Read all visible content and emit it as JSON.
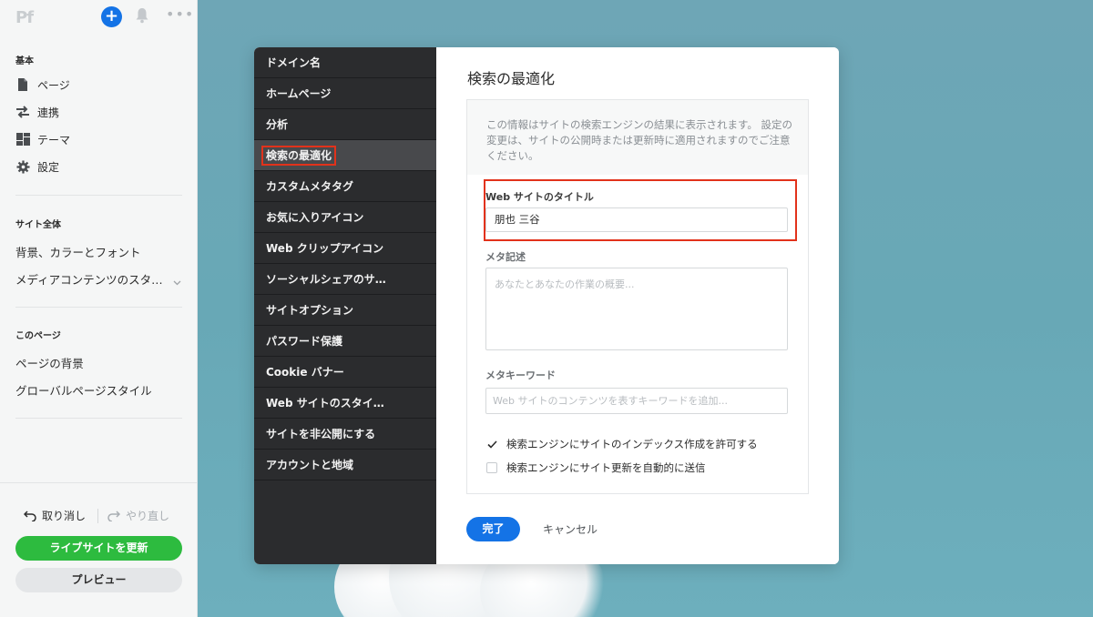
{
  "sidebar": {
    "logo": "Pf",
    "sections": {
      "basic": "基本",
      "site_wide": "サイト全体",
      "this_page": "このページ"
    },
    "basic_items": [
      "ページ",
      "連携",
      "テーマ",
      "設定"
    ],
    "site_items": [
      "背景、カラーとフォント",
      "メディアコンテンツのスタ…"
    ],
    "page_items": [
      "ページの背景",
      "グローバルページスタイル"
    ],
    "undo": "取り消し",
    "redo": "やり直し",
    "update_button": "ライブサイトを更新",
    "preview_button": "プレビュー"
  },
  "modal": {
    "nav_items": [
      "ドメイン名",
      "ホームページ",
      "分析",
      "検索の最適化",
      "カスタムメタタグ",
      "お気に入りアイコン",
      "Web クリップアイコン",
      "ソーシャルシェアのサ…",
      "サイトオプション",
      "パスワード保護",
      "Cookie バナー",
      "Web サイトのスタイ…",
      "サイトを非公開にする",
      "アカウントと地域"
    ],
    "active_index": 3,
    "title": "検索の最適化",
    "info_text": "この情報はサイトの検索エンジンの結果に表示されます。 設定の変更は、サイトの公開時または更新時に適用されますのでご注意ください。",
    "site_title_label": "Web サイトのタイトル",
    "site_title_value": "朋也 三谷",
    "meta_desc_label": "メタ記述",
    "meta_desc_placeholder": "あなたとあなたの作業の概要...",
    "meta_keywords_label": "メタキーワード",
    "meta_keywords_placeholder": "Web サイトのコンテンツを表すキーワードを追加...",
    "checkbox_index_label": "検索エンジンにサイトのインデックス作成を許可する",
    "checkbox_index_checked": true,
    "checkbox_auto_label": "検索エンジンにサイト更新を自動的に送信",
    "checkbox_auto_checked": false,
    "done_button": "完了",
    "cancel_button": "キャンセル"
  },
  "colors": {
    "accent": "#1473e6",
    "update_green": "#2dbb3f",
    "highlight_red": "#e2321b",
    "modal_nav_bg": "#2b2c2e"
  }
}
